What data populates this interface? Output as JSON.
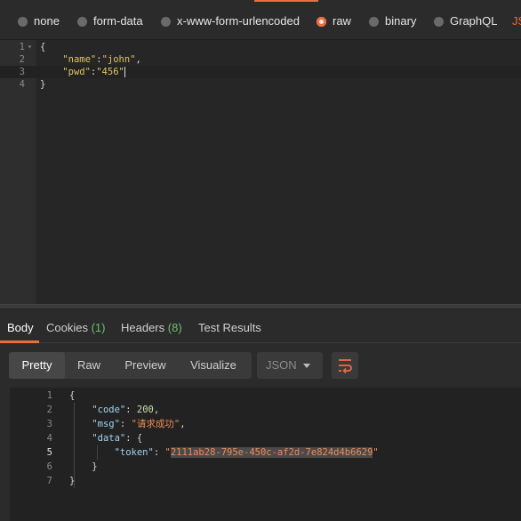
{
  "body_types": [
    {
      "label": "none",
      "selected": false
    },
    {
      "label": "form-data",
      "selected": false
    },
    {
      "label": "x-www-form-urlencoded",
      "selected": false
    },
    {
      "label": "raw",
      "selected": true
    },
    {
      "label": "binary",
      "selected": false
    },
    {
      "label": "GraphQL",
      "selected": false
    },
    {
      "label": "JS",
      "selected": false
    }
  ],
  "request_editor": {
    "lines": [
      {
        "n": "1",
        "open": "{"
      },
      {
        "n": "2",
        "key": "\"name\"",
        "colon": ":",
        "value": "\"john\"",
        "tail": ","
      },
      {
        "n": "3",
        "key": "\"pwd\"",
        "colon": ":",
        "value": "\"456\"",
        "tail": ""
      },
      {
        "n": "4",
        "close": "}"
      }
    ]
  },
  "response_tabs": [
    {
      "label": "Body",
      "count": ""
    },
    {
      "label": "Cookies",
      "count": "(1)"
    },
    {
      "label": "Headers",
      "count": "(8)"
    },
    {
      "label": "Test Results",
      "count": ""
    }
  ],
  "view_modes": [
    "Pretty",
    "Raw",
    "Preview",
    "Visualize"
  ],
  "active_view": "Pretty",
  "format": "JSON",
  "icons": {
    "wrap": "wrap-lines-icon",
    "dropdown": "chevron-down-icon"
  },
  "colors": {
    "accent": "#f26b3a",
    "count": "#6fbf6f"
  },
  "response": {
    "lines": [
      "1",
      "2",
      "3",
      "4",
      "5",
      "6",
      "7"
    ],
    "open": "{",
    "code_key": "\"code\"",
    "code_value": "200",
    "msg_key": "\"msg\"",
    "msg_value": "\"请求成功\"",
    "data_key": "\"data\"",
    "data_open": "{",
    "token_key": "\"token\"",
    "token_value": "2111ab28-795e-450c-af2d-7e824d4b6629",
    "data_close": "}",
    "close": "}",
    "colon_sp": ": ",
    "comma": ",",
    "quote": "\""
  }
}
